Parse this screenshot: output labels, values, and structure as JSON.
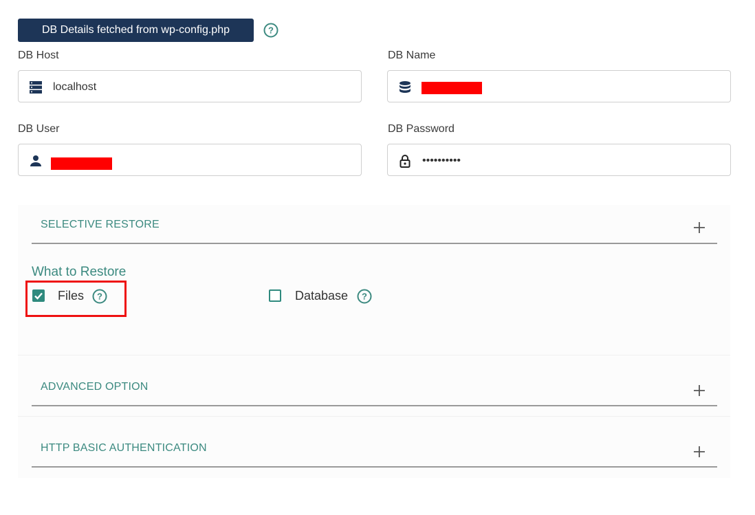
{
  "header": {
    "badge_label": "DB Details fetched from wp-config.php"
  },
  "db_host": {
    "label": "DB Host",
    "value": "localhost",
    "icon": "server-icon"
  },
  "db_name": {
    "label": "DB Name",
    "value": "",
    "icon": "database-icon"
  },
  "db_user": {
    "label": "DB User",
    "value": "",
    "icon": "user-icon"
  },
  "db_password": {
    "label": "DB Password",
    "value": "••••••••••",
    "icon": "lock-icon"
  },
  "sections": {
    "selective_restore": "SELECTIVE RESTORE",
    "advanced_option": "ADVANCED OPTION",
    "http_basic_auth": "HTTP BASIC AUTHENTICATION"
  },
  "what_to_restore": {
    "title": "What to Restore",
    "files": {
      "label": "Files",
      "checked": true
    },
    "database": {
      "label": "Database",
      "checked": false
    }
  },
  "colors": {
    "accent": "#3c8a80",
    "badge_bg": "#1d3557",
    "highlight": "#ee1111"
  }
}
